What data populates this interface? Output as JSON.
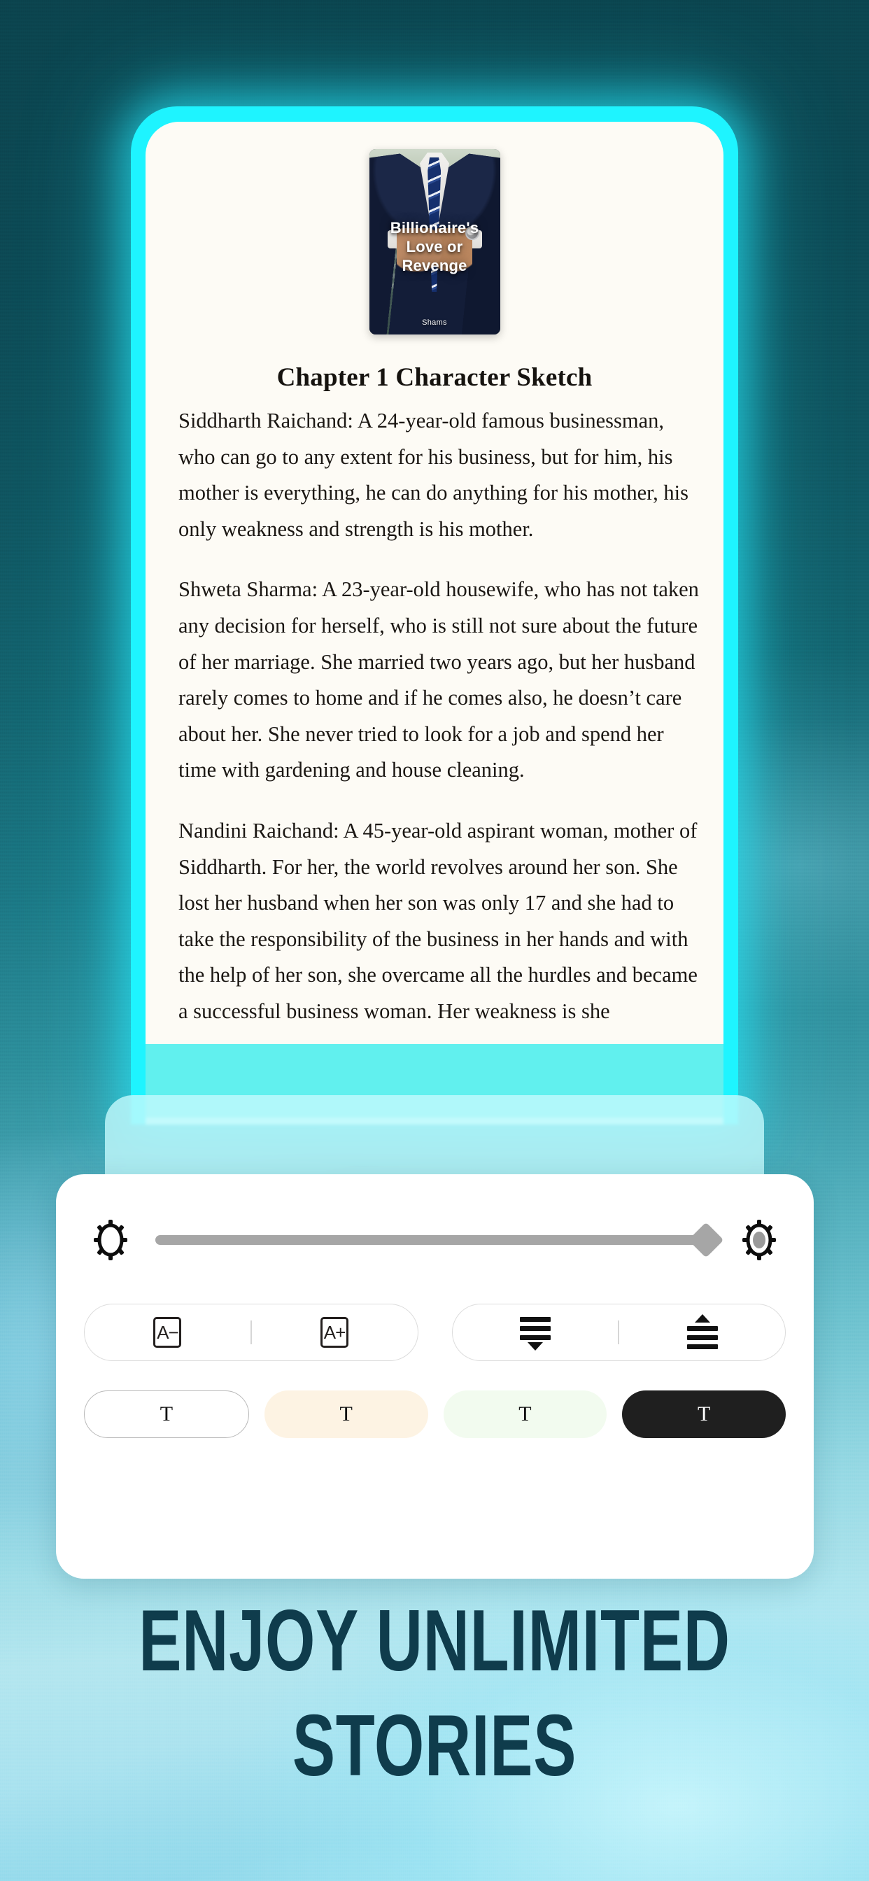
{
  "background": {
    "top_color": "#0b434d",
    "bottom_color": "#8fd8ea"
  },
  "phone": {
    "frame_color": "#1ef4ff",
    "screen_color": "#fdfbf5"
  },
  "book_cover": {
    "title": "Billionaire's\nLove or Revenge",
    "title_line1": "Billionaire's",
    "title_line2": "Love or Revenge",
    "author": "Shams"
  },
  "reader": {
    "chapter_title": "Chapter 1 Character Sketch",
    "paragraphs": [
      "Siddharth Raichand: A 24-year-old famous businessman, who can go to any extent for his business, but for him, his mother is everything, he can do anything for his mother, his only weakness and strength is his mother.",
      "Shweta Sharma: A 23-year-old housewife, who has not taken any decision for herself, who is still not sure about the future of her marriage. She married two years ago, but her husband rarely comes to home and if he comes also, he doesn’t care about her. She never tried to look for a job and spend her time with gardening and house cleaning.",
      "Nandini Raichand: A 45-year-old aspirant woman, mother of Siddharth. For her, the world revolves around her son. She lost her husband when her son was only 17 and she had to take the responsibility of the business in her hands and with the help of her son, she overcame all the hurdles and became a successful business woman. Her weakness is she"
    ],
    "highlight_color": "#62f4f8"
  },
  "settings": {
    "brightness": {
      "low_icon": "sun-low-icon",
      "high_icon": "sun-high-icon",
      "value_percent": 100,
      "track_color": "#a6a6a6"
    },
    "font_size": {
      "decrease_label": "A−",
      "increase_label": "A+"
    },
    "line_spacing": {
      "decrease_icon": "line-spacing-decrease-icon",
      "increase_icon": "line-spacing-increase-icon"
    },
    "themes": [
      {
        "name": "white",
        "label": "T",
        "bg": "#ffffff",
        "fg": "#111111",
        "selected": false
      },
      {
        "name": "sepia",
        "label": "T",
        "bg": "#fdf3e3",
        "fg": "#111111",
        "selected": false
      },
      {
        "name": "green",
        "label": "T",
        "bg": "#f2fbef",
        "fg": "#111111",
        "selected": false
      },
      {
        "name": "dark",
        "label": "T",
        "bg": "#1f1f1f",
        "fg": "#ffffff",
        "selected": true
      }
    ]
  },
  "promo": {
    "line1": "ENJOY UNLIMITED",
    "line2": "STORIES",
    "color": "#0f3c4c"
  }
}
